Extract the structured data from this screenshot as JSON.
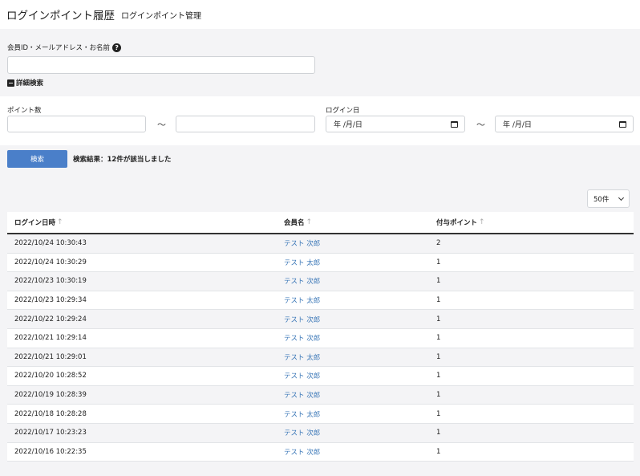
{
  "header": {
    "title": "ログインポイント履歴",
    "subtitle": "ログインポイント管理"
  },
  "search": {
    "member_label": "会員ID・メールアドレス・お名前",
    "help_icon": "?",
    "member_value": "",
    "advanced_toggle": "詳細検索",
    "minus_icon": "−",
    "points_label": "ポイント数",
    "points_from": "",
    "points_to": "",
    "tilde": "〜",
    "login_date_label": "ログイン日",
    "date_placeholder": "年 /月/日",
    "button_label": "検索",
    "result_text": "検索結果：12件が該当しました"
  },
  "per_page": {
    "selected": "50件"
  },
  "table": {
    "headers": [
      "ログイン日時",
      "会員名",
      "付与ポイント"
    ],
    "sort_icon": "↑",
    "rows": [
      {
        "datetime": "2022/10/24 10:30:43",
        "member": "テスト 次郎",
        "points": "2"
      },
      {
        "datetime": "2022/10/24 10:30:29",
        "member": "テスト 太郎",
        "points": "1"
      },
      {
        "datetime": "2022/10/23 10:30:19",
        "member": "テスト 次郎",
        "points": "1"
      },
      {
        "datetime": "2022/10/23 10:29:34",
        "member": "テスト 太郎",
        "points": "1"
      },
      {
        "datetime": "2022/10/22 10:29:24",
        "member": "テスト 次郎",
        "points": "1"
      },
      {
        "datetime": "2022/10/21 10:29:14",
        "member": "テスト 次郎",
        "points": "1"
      },
      {
        "datetime": "2022/10/21 10:29:01",
        "member": "テスト 太郎",
        "points": "1"
      },
      {
        "datetime": "2022/10/20 10:28:52",
        "member": "テスト 次郎",
        "points": "1"
      },
      {
        "datetime": "2022/10/19 10:28:39",
        "member": "テスト 次郎",
        "points": "1"
      },
      {
        "datetime": "2022/10/18 10:28:28",
        "member": "テスト 太郎",
        "points": "1"
      },
      {
        "datetime": "2022/10/17 10:23:23",
        "member": "テスト 次郎",
        "points": "1"
      },
      {
        "datetime": "2022/10/16 10:22:35",
        "member": "テスト 次郎",
        "points": "1"
      }
    ]
  },
  "colors": {
    "accent": "#4a7fc9",
    "link": "#3c78b8",
    "band": "#f4f4f6"
  }
}
